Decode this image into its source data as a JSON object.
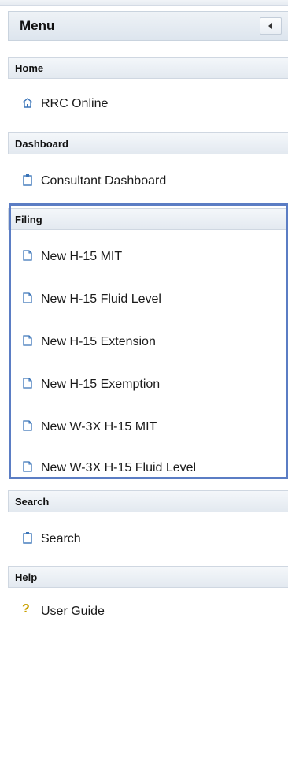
{
  "menu": {
    "title": "Menu"
  },
  "sections": {
    "home": {
      "header": "Home",
      "items": [
        {
          "label": "RRC Online",
          "icon": "home-icon"
        }
      ]
    },
    "dashboard": {
      "header": "Dashboard",
      "items": [
        {
          "label": "Consultant Dashboard",
          "icon": "clipboard-icon"
        }
      ]
    },
    "filing": {
      "header": "Filing",
      "items": [
        {
          "label": "New H-15 MIT",
          "icon": "document-icon"
        },
        {
          "label": "New H-15 Fluid Level",
          "icon": "document-icon"
        },
        {
          "label": "New H-15 Extension",
          "icon": "document-icon"
        },
        {
          "label": "New H-15 Exemption",
          "icon": "document-icon"
        },
        {
          "label": "New W-3X H-15 MIT",
          "icon": "document-icon"
        },
        {
          "label": "New W-3X H-15 Fluid Level",
          "icon": "document-icon"
        }
      ]
    },
    "search": {
      "header": "Search",
      "items": [
        {
          "label": "Search",
          "icon": "clipboard-icon"
        }
      ]
    },
    "help": {
      "header": "Help",
      "items": [
        {
          "label": "User Guide",
          "icon": "help-icon"
        }
      ]
    }
  },
  "colors": {
    "highlight_border": "#5b7dc4",
    "header_bg": "#e3e9f0",
    "icon_blue": "#3a74b8"
  }
}
